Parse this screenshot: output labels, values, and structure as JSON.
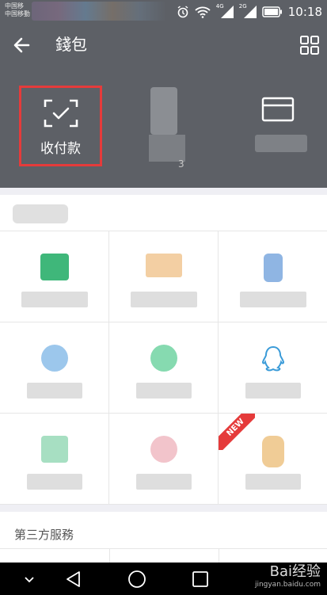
{
  "status_bar": {
    "carrier_line1": "中国移",
    "carrier_line2": "中国移動",
    "time": "10:18",
    "network_4g": "4G",
    "network_2g": "2G"
  },
  "header": {
    "title": "錢包",
    "pay_label": "收付款"
  },
  "wallet_grid": {
    "new_badge": "NEW"
  },
  "third_party": {
    "title": "第三方服務"
  },
  "watermark": {
    "brand": "Bai经验",
    "url": "jingyan.baidu.com"
  },
  "colors": {
    "header_bg": "#5d6066",
    "highlight_border": "#e53b3b",
    "badge": "#e53b3b"
  }
}
